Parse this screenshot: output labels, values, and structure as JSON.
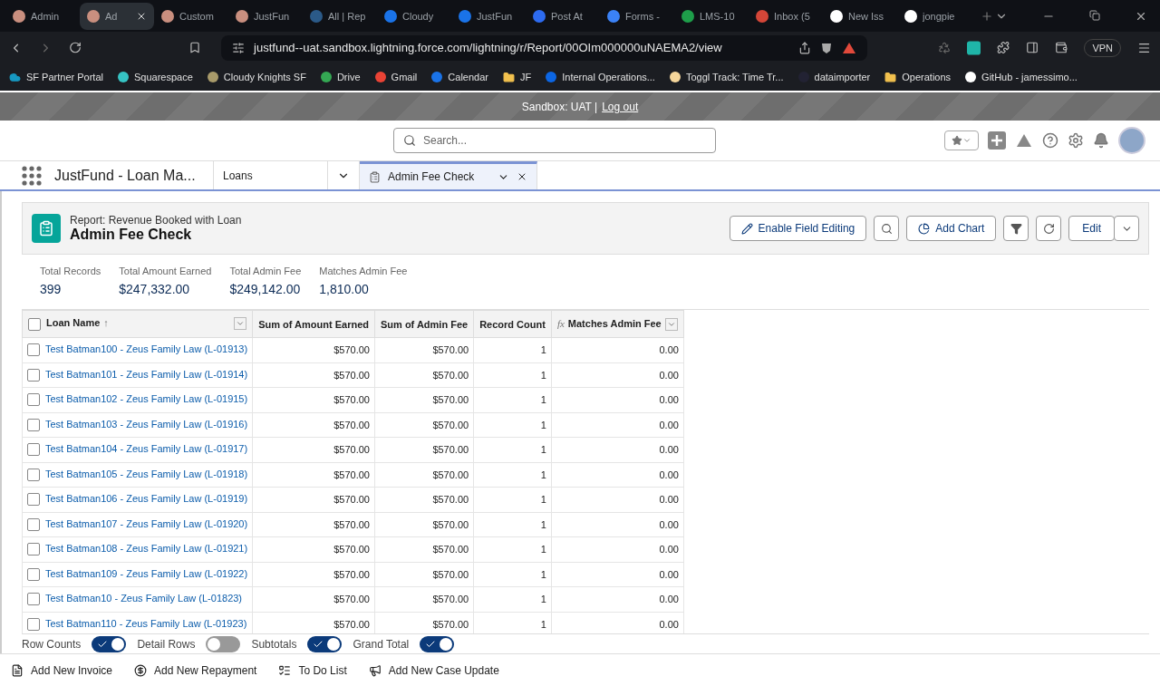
{
  "browser": {
    "tabs": [
      {
        "title": "Admin",
        "selected": false
      },
      {
        "title": "Ad",
        "selected": true
      },
      {
        "title": "Custom",
        "selected": false
      },
      {
        "title": "JustFun",
        "selected": false
      },
      {
        "title": "All | Rep",
        "selected": false
      },
      {
        "title": "Cloudy",
        "selected": false
      },
      {
        "title": "JustFun",
        "selected": false
      },
      {
        "title": "Post At",
        "selected": false
      },
      {
        "title": "Forms -",
        "selected": false
      },
      {
        "title": "LMS-10",
        "selected": false
      },
      {
        "title": "Inbox (5",
        "selected": false
      },
      {
        "title": "New Iss",
        "selected": false
      },
      {
        "title": "jongpie",
        "selected": false
      }
    ],
    "url": "justfund--uat.sandbox.lightning.force.com/lightning/r/Report/00OIm000000uNAEMA2/view",
    "vpn": "VPN",
    "bookmarks": [
      "SF Partner Portal",
      "Squarespace",
      "Cloudy Knights SF",
      "Drive",
      "Gmail",
      "Calendar",
      "JF",
      "Internal Operations...",
      "Toggl Track: Time Tr...",
      "dataimporter",
      "Operations",
      "GitHub - jamessimo..."
    ]
  },
  "sandbox_bar": {
    "text": "Sandbox: UAT |",
    "link": "Log out"
  },
  "header": {
    "search": {
      "placeholder": "Search..."
    }
  },
  "nav": {
    "app_name": "JustFund - Loan Ma...",
    "items": [
      {
        "label": "Loans",
        "selected": false
      },
      {
        "label": "Admin Fee Check",
        "selected": true
      }
    ]
  },
  "report": {
    "subtitle": "Report: Revenue Booked with Loan",
    "title": "Admin Fee Check",
    "actions": [
      "Enable Field Editing",
      "Add Chart",
      "Edit"
    ],
    "summary": [
      {
        "label": "Total Records",
        "value": "399"
      },
      {
        "label": "Total Amount Earned",
        "value": "$247,332.00"
      },
      {
        "label": "Total Admin Fee",
        "value": "$249,142.00"
      },
      {
        "label": "Matches Admin Fee",
        "value": "1,810.00"
      }
    ],
    "table": {
      "columns": [
        "Loan Name",
        "Sum of Amount Earned",
        "Sum of Admin Fee",
        "Record Count",
        "Matches Admin Fee"
      ],
      "sort_mark": "↑",
      "all_checked": false,
      "formula_mark": "fx",
      "rows": [
        {
          "cells": [
            "Test Batman100 - Zeus Family Law (L-01913)",
            "$570.00",
            "$570.00",
            "1",
            "0.00"
          ],
          "checked": false
        },
        {
          "cells": [
            "Test Batman101 - Zeus Family Law (L-01914)",
            "$570.00",
            "$570.00",
            "1",
            "0.00"
          ],
          "checked": false
        },
        {
          "cells": [
            "Test Batman102 - Zeus Family Law (L-01915)",
            "$570.00",
            "$570.00",
            "1",
            "0.00"
          ],
          "checked": false
        },
        {
          "cells": [
            "Test Batman103 - Zeus Family Law (L-01916)",
            "$570.00",
            "$570.00",
            "1",
            "0.00"
          ],
          "checked": false
        },
        {
          "cells": [
            "Test Batman104 - Zeus Family Law (L-01917)",
            "$570.00",
            "$570.00",
            "1",
            "0.00"
          ],
          "checked": false
        },
        {
          "cells": [
            "Test Batman105 - Zeus Family Law (L-01918)",
            "$570.00",
            "$570.00",
            "1",
            "0.00"
          ],
          "checked": false
        },
        {
          "cells": [
            "Test Batman106 - Zeus Family Law (L-01919)",
            "$570.00",
            "$570.00",
            "1",
            "0.00"
          ],
          "checked": false
        },
        {
          "cells": [
            "Test Batman107 - Zeus Family Law (L-01920)",
            "$570.00",
            "$570.00",
            "1",
            "0.00"
          ],
          "checked": false
        },
        {
          "cells": [
            "Test Batman108 - Zeus Family Law (L-01921)",
            "$570.00",
            "$570.00",
            "1",
            "0.00"
          ],
          "checked": false
        },
        {
          "cells": [
            "Test Batman109 - Zeus Family Law (L-01922)",
            "$570.00",
            "$570.00",
            "1",
            "0.00"
          ],
          "checked": false
        },
        {
          "cells": [
            "Test Batman10 - Zeus Family Law (L-01823)",
            "$570.00",
            "$570.00",
            "1",
            "0.00"
          ],
          "checked": false
        },
        {
          "cells": [
            "Test Batman110 - Zeus Family Law (L-01923)",
            "$570.00",
            "$570.00",
            "1",
            "0.00"
          ],
          "checked": false
        }
      ]
    },
    "toggles": [
      {
        "label": "Row Counts",
        "on": true
      },
      {
        "label": "Detail Rows",
        "on": false
      },
      {
        "label": "Subtotals",
        "on": true
      },
      {
        "label": "Grand Total",
        "on": true
      }
    ]
  },
  "utility_bar": [
    {
      "label": "Add New Invoice",
      "kind": "invoice"
    },
    {
      "label": "Add New Repayment",
      "kind": "money"
    },
    {
      "label": "To Do List",
      "kind": "list"
    },
    {
      "label": "Add New Case Update",
      "kind": "update"
    }
  ]
}
